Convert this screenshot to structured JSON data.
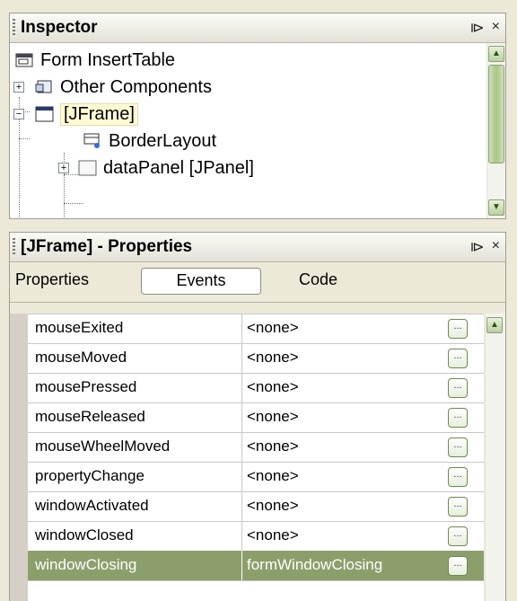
{
  "inspector": {
    "title": "Inspector",
    "pin_glyph": "⧐",
    "close_glyph": "×",
    "tree": [
      {
        "label": "Form InsertTable"
      },
      {
        "label": "Other Components"
      },
      {
        "label": "[JFrame]"
      },
      {
        "label": "BorderLayout"
      },
      {
        "label": "dataPanel [JPanel]"
      }
    ],
    "scroll_up": "▲",
    "scroll_down": "▼"
  },
  "properties": {
    "title": "[JFrame] - Properties",
    "pin_glyph": "⧐",
    "close_glyph": "×",
    "tabs": [
      "Properties",
      "Events",
      "Code"
    ],
    "active_tab": "Events",
    "rows": [
      {
        "name": "mouseExited",
        "value": "<none>"
      },
      {
        "name": "mouseMoved",
        "value": "<none>"
      },
      {
        "name": "mousePressed",
        "value": "<none>"
      },
      {
        "name": "mouseReleased",
        "value": "<none>"
      },
      {
        "name": "mouseWheelMoved",
        "value": "<none>"
      },
      {
        "name": "propertyChange",
        "value": "<none>"
      },
      {
        "name": "windowActivated",
        "value": "<none>"
      },
      {
        "name": "windowClosed",
        "value": "<none>"
      },
      {
        "name": "windowClosing",
        "value": "formWindowClosing"
      }
    ],
    "selected_row": "windowClosing",
    "ellipsis": "...",
    "scroll_up": "▲"
  },
  "colors": {
    "selection": "#8b9f6b",
    "scroll_green": "#b9d19c",
    "chrome": "#ece9d8"
  }
}
